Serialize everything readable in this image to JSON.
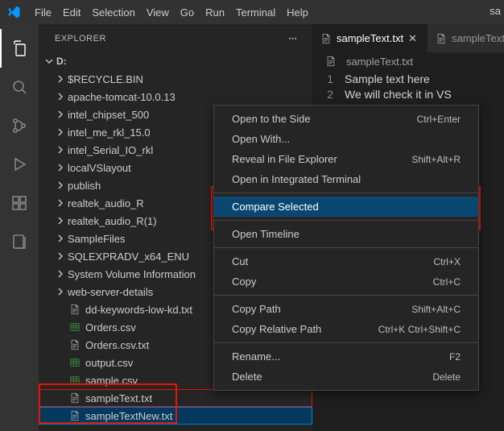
{
  "menubar": {
    "items": [
      "File",
      "Edit",
      "Selection",
      "View",
      "Go",
      "Run",
      "Terminal",
      "Help"
    ],
    "title_fragment": "sa"
  },
  "activitybar": {
    "icons": [
      "files",
      "search",
      "source-control",
      "debug",
      "extensions",
      "references"
    ]
  },
  "sidebar": {
    "title": "EXPLORER",
    "root": "D:",
    "items": [
      {
        "type": "folder",
        "label": "$RECYCLE.BIN"
      },
      {
        "type": "folder",
        "label": "apache-tomcat-10.0.13"
      },
      {
        "type": "folder",
        "label": "intel_chipset_500"
      },
      {
        "type": "folder",
        "label": "intel_me_rkl_15.0"
      },
      {
        "type": "folder",
        "label": "intel_Serial_IO_rkl"
      },
      {
        "type": "folder",
        "label": "localVSlayout"
      },
      {
        "type": "folder",
        "label": "publish"
      },
      {
        "type": "folder",
        "label": "realtek_audio_R"
      },
      {
        "type": "folder",
        "label": "realtek_audio_R(1)"
      },
      {
        "type": "folder",
        "label": "SampleFiles"
      },
      {
        "type": "folder",
        "label": "SQLEXPRADV_x64_ENU"
      },
      {
        "type": "folder",
        "label": "System Volume Information"
      },
      {
        "type": "folder",
        "label": "web-server-details"
      },
      {
        "type": "txt",
        "label": "dd-keywords-low-kd.txt"
      },
      {
        "type": "csv",
        "label": "Orders.csv"
      },
      {
        "type": "txt",
        "label": "Orders.csv.txt"
      },
      {
        "type": "csv",
        "label": "output.csv"
      },
      {
        "type": "csv",
        "label": "sample.csv"
      },
      {
        "type": "txt",
        "label": "sampleText.txt",
        "selected": "red"
      },
      {
        "type": "txt",
        "label": "sampleTextNew.txt",
        "selected": "blue"
      }
    ]
  },
  "editor": {
    "tabs": [
      {
        "label": "sampleText.txt",
        "active": true
      },
      {
        "label": "sampleText",
        "active": false
      }
    ],
    "breadcrumb": "sampleText.txt",
    "lines": [
      {
        "num": "1",
        "text": "Sample text here"
      },
      {
        "num": "2",
        "text": "We will check it in VS"
      },
      {
        "num": "3",
        "text": ""
      }
    ]
  },
  "context_menu": {
    "items": [
      {
        "label": "Open to the Side",
        "key": "Ctrl+Enter"
      },
      {
        "label": "Open With..."
      },
      {
        "label": "Reveal in File Explorer",
        "key": "Shift+Alt+R"
      },
      {
        "label": "Open in Integrated Terminal"
      },
      {
        "sep": true
      },
      {
        "label": "Compare Selected",
        "hover": true
      },
      {
        "sep": true
      },
      {
        "label": "Open Timeline"
      },
      {
        "sep": true
      },
      {
        "label": "Cut",
        "key": "Ctrl+X"
      },
      {
        "label": "Copy",
        "key": "Ctrl+C"
      },
      {
        "sep": true
      },
      {
        "label": "Copy Path",
        "key": "Shift+Alt+C"
      },
      {
        "label": "Copy Relative Path",
        "key": "Ctrl+K Ctrl+Shift+C"
      },
      {
        "sep": true
      },
      {
        "label": "Rename...",
        "key": "F2"
      },
      {
        "label": "Delete",
        "key": "Delete"
      }
    ]
  }
}
